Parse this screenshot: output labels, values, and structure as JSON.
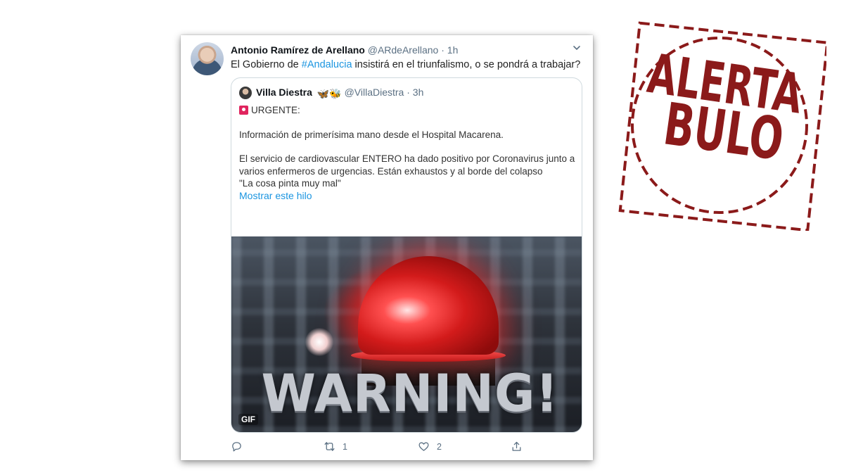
{
  "tweet": {
    "author_name": "Antonio Ramírez de Arellano",
    "handle": "@ARdeArellano",
    "separator": "·",
    "time": "1h",
    "text_before": "El Gobierno de ",
    "hashtag": "#Andalucia",
    "text_after": " insistirá en el triunfalismo, o se pondrá a trabajar?"
  },
  "quoted": {
    "author_name": "Villa Diestra",
    "emojis": "🦋🐝",
    "handle": "@VillaDiestra",
    "separator": "·",
    "time": "3h",
    "urgent": "URGENTE:",
    "line1": "Información de primerísima mano desde el Hospital Macarena.",
    "line2": "El servicio de cardiovascular ENTERO ha dado positivo por Coronavirus junto a varios enfermeros de urgencias. Están exhaustos y al borde del colapso",
    "line3": "\"La cosa pinta muy mal\"",
    "show_thread": "Mostrar este hilo",
    "gif_caption": "WARNING!",
    "gif_badge": "GIF"
  },
  "actions": {
    "reply_count": "",
    "retweet_count": "1",
    "like_count": "2"
  },
  "stamp": {
    "line1": "ALERTA",
    "line2": "BULO",
    "color": "#8b1a1a"
  },
  "colors": {
    "link": "#1b95e0",
    "muted": "#5b7083"
  }
}
